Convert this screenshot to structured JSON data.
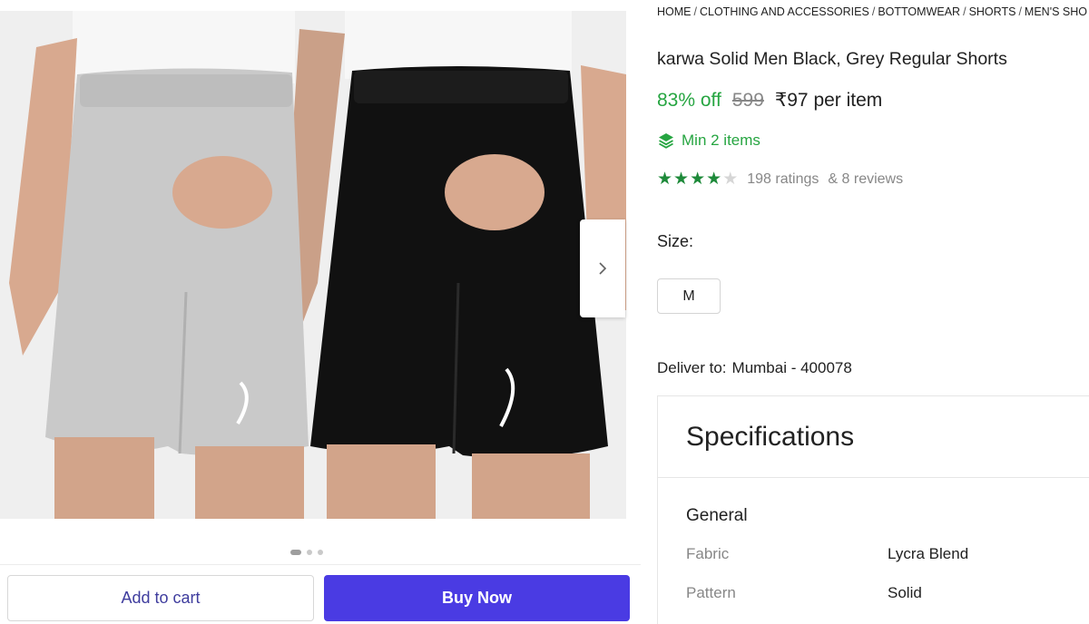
{
  "gallery": {
    "photo_alt": "",
    "dots": [
      true,
      false,
      false
    ]
  },
  "actions": {
    "add_to_cart": "Add to cart",
    "buy_now": "Buy Now"
  },
  "breadcrumb": [
    "HOME",
    "CLOTHING AND ACCESSORIES",
    "BOTTOMWEAR",
    "SHORTS",
    "MEN'S SHO"
  ],
  "product": {
    "title": "karwa Solid Men Black, Grey Regular Shorts",
    "discount": "83% off",
    "mrp": "599",
    "price": "₹97 per item",
    "min_items": "Min 2 items",
    "rating_value": 4,
    "rating_max": 5,
    "ratings": "198 ratings",
    "reviews": "& 8 reviews"
  },
  "size": {
    "label": "Size:",
    "selected": "M"
  },
  "delivery": {
    "label": "Deliver to:",
    "location": "Mumbai - 400078"
  },
  "specifications": {
    "title": "Specifications",
    "section": "General",
    "rows": [
      {
        "key": "Fabric",
        "value": "Lycra Blend"
      },
      {
        "key": "Pattern",
        "value": "Solid"
      }
    ]
  },
  "colors": {
    "accent_green": "#26a541",
    "buy_now": "#4a3be3",
    "cart_text": "#3f3d9e"
  }
}
